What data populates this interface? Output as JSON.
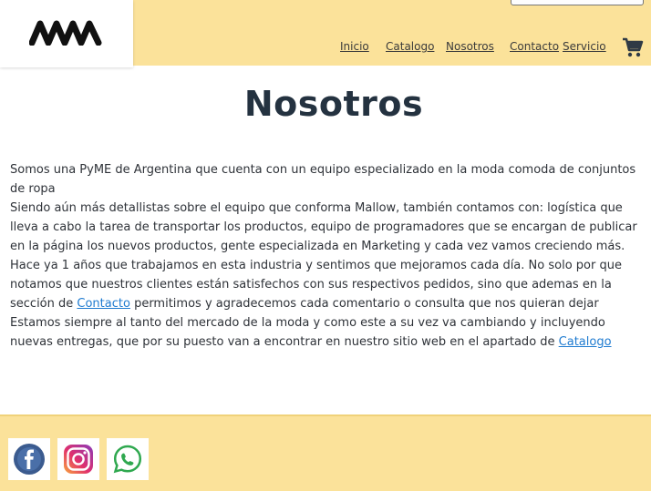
{
  "header": {
    "logo_text": "MW",
    "nav": [
      "Inicio",
      "Catalogo",
      "Nosotros",
      "Contacto",
      "Servicio"
    ],
    "cart_icon": "cart-icon"
  },
  "page": {
    "title": "Nosotros",
    "p1": "Somos una PyME de Argentina que cuenta con un equipo especializado en la moda comoda de conjuntos de ropa",
    "p2": "Siendo aún más detallistas sobre el equipo que conforma Mallow, también contamos con: logística que lleva a cabo la tarea de transportar los productos, equipo de programadores que se encargan de publicar en la página los nuevos productos, gente especializada en Marketing y cada vez vamos creciendo más.",
    "p3_before": "Hace ya 1 años que trabajamos en esta industria y sentimos que mejoramos cada día. No solo por que notamos que nuestros clientes están satisfechos con sus respectivos pedidos, sino que ademas en la sección de ",
    "p3_link": "Contacto",
    "p3_after": " permitimos y agradecemos cada comentario o consulta que nos quieran dejar",
    "p4_before": "Estamos siempre al tanto del mercado de la moda y como este a su vez va cambiando y incluyendo nuevas entregas, que por su puesto van a encontrar en nuestro sitio web en el apartado de ",
    "p4_link": "Catalogo"
  },
  "footer": {
    "social_icons": [
      "facebook-icon",
      "instagram-icon",
      "whatsapp-icon"
    ]
  },
  "colors": {
    "header_bg": "#fbe29a",
    "title": "#243240",
    "link": "#1f7bd0"
  }
}
